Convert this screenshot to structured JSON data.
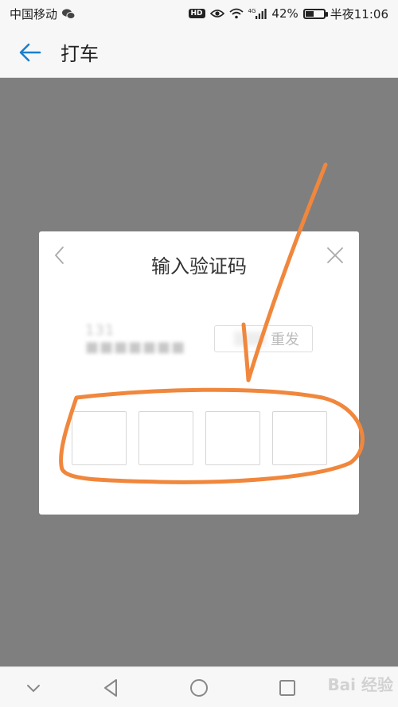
{
  "status_bar": {
    "carrier": "中国移动",
    "hd_badge": "HD",
    "network_type": "4G",
    "battery_percent": "42%",
    "battery_level": 0.42,
    "time": "半夜11:06"
  },
  "header": {
    "back_icon": "arrow-left-icon",
    "title": "打车"
  },
  "dialog": {
    "title": "输入验证码",
    "phone_number": "131 ■■■■■■■",
    "resend_label": "重发",
    "code_boxes": [
      "",
      "",
      "",
      ""
    ]
  },
  "colors": {
    "accent": "#1a7fd0",
    "overlay": "#7f7f7f",
    "annotation": "#f0873c"
  },
  "watermark": "Bai 经验"
}
